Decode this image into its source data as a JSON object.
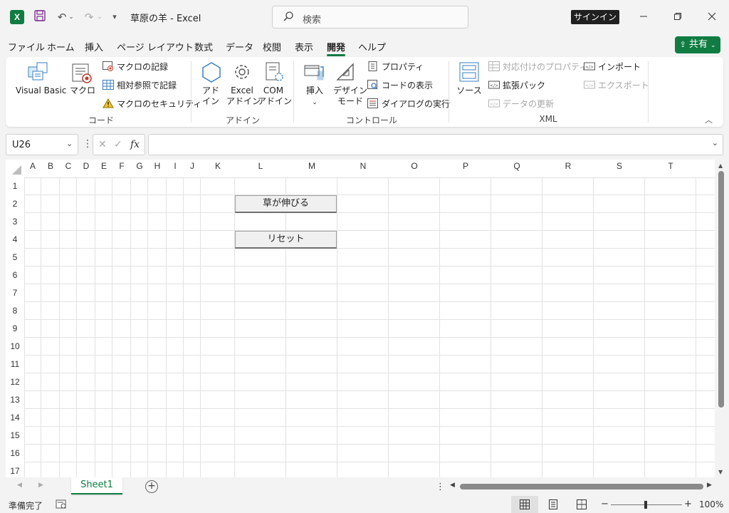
{
  "window": {
    "app_icon": "X",
    "title": "草原の羊  -  Excel",
    "search_placeholder": "検索",
    "signin_label": "サインイン"
  },
  "menu": {
    "items": [
      "ファイル",
      "ホーム",
      "挿入",
      "ページ レイアウト",
      "数式",
      "データ",
      "校閲",
      "表示",
      "開発",
      "ヘルプ"
    ],
    "active": "開発",
    "share_label": "共有"
  },
  "ribbon": {
    "code": {
      "group_label": "コード",
      "visual_basic": "Visual Basic",
      "macro": "マクロ",
      "record_macro": "マクロの記録",
      "relative_ref": "相対参照で記録",
      "macro_security": "マクロのセキュリティ"
    },
    "addins": {
      "group_label": "アドイン",
      "addin_line1": "アド",
      "addin_line2": "イン",
      "excel_addin_line1": "Excel",
      "excel_addin_line2": "アドイン",
      "com_addin_line1": "COM",
      "com_addin_line2": "アドイン"
    },
    "controls": {
      "group_label": "コントロール",
      "insert": "挿入",
      "design_mode_line1": "デザイン",
      "design_mode_line2": "モード",
      "properties": "プロパティ",
      "view_code": "コードの表示",
      "run_dialog": "ダイアログの実行"
    },
    "xml": {
      "group_label": "XML",
      "source": "ソース",
      "map_properties": "対応付けのプロパティ",
      "expansion_packs": "拡張パック",
      "refresh_data": "データの更新",
      "import": "インポート",
      "export": "エクスポート"
    }
  },
  "formula_bar": {
    "name_box": "U26",
    "fx": "fx",
    "formula": ""
  },
  "grid": {
    "columns": [
      "A",
      "B",
      "C",
      "D",
      "E",
      "F",
      "G",
      "H",
      "I",
      "J",
      "K",
      "L",
      "M",
      "N",
      "O",
      "P",
      "Q",
      "R",
      "S",
      "T"
    ],
    "rows": [
      "1",
      "2",
      "3",
      "4",
      "5",
      "6",
      "7",
      "8",
      "9",
      "10",
      "11",
      "12",
      "13",
      "14",
      "15",
      "16",
      "17"
    ],
    "buttons": [
      "草が伸びる",
      "リセット"
    ]
  },
  "sheet_tabs": {
    "active": "Sheet1"
  },
  "status": {
    "text": "準備完了",
    "zoom": "100%"
  },
  "colors": {
    "accent": "#107c41",
    "ribbon_bg": "#ffffff",
    "window_bg": "#f3f3f3"
  }
}
